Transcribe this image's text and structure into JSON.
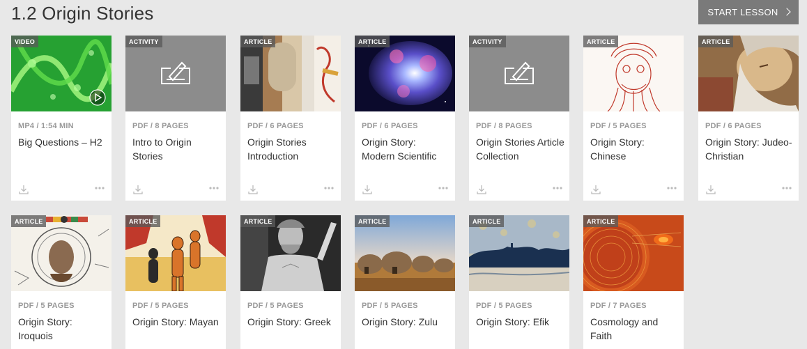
{
  "header": {
    "title": "1.2 Origin Stories",
    "start_label": "START LESSON"
  },
  "cards": [
    {
      "type": "VIDEO",
      "meta": "MP4 / 1:54 MIN",
      "title": "Big Questions – H2"
    },
    {
      "type": "ACTIVITY",
      "meta": "PDF / 8 PAGES",
      "title": "Intro to Origin Stories"
    },
    {
      "type": "ARTICLE",
      "meta": "PDF / 6 PAGES",
      "title": "Origin Stories Introduction"
    },
    {
      "type": "ARTICLE",
      "meta": "PDF / 6 PAGES",
      "title": "Origin Story: Modern Scientific"
    },
    {
      "type": "ACTIVITY",
      "meta": "PDF / 8 PAGES",
      "title": "Origin Stories Article Collection"
    },
    {
      "type": "ARTICLE",
      "meta": "PDF / 5 PAGES",
      "title": "Origin Story: Chinese"
    },
    {
      "type": "ARTICLE",
      "meta": "PDF / 6 PAGES",
      "title": "Origin Story: Judeo-Christian"
    },
    {
      "type": "ARTICLE",
      "meta": "PDF / 5 PAGES",
      "title": "Origin Story: Iroquois"
    },
    {
      "type": "ARTICLE",
      "meta": "PDF / 5 PAGES",
      "title": "Origin Story: Mayan"
    },
    {
      "type": "ARTICLE",
      "meta": "PDF / 5 PAGES",
      "title": "Origin Story: Greek"
    },
    {
      "type": "ARTICLE",
      "meta": "PDF / 5 PAGES",
      "title": "Origin Story: Zulu"
    },
    {
      "type": "ARTICLE",
      "meta": "PDF / 5 PAGES",
      "title": "Origin Story: Efik"
    },
    {
      "type": "ARTICLE",
      "meta": "PDF / 7 PAGES",
      "title": "Cosmology and Faith"
    }
  ],
  "icons": {
    "download": "download-icon",
    "more": "more-options-icon",
    "activity": "pencil-form-icon",
    "play": "play-icon"
  },
  "colors": {
    "page_bg": "#e8e8e8",
    "button_bg": "#7a7a7a",
    "activity_bg": "#8c8c8c",
    "badge_bg": "#5a5a5a"
  }
}
